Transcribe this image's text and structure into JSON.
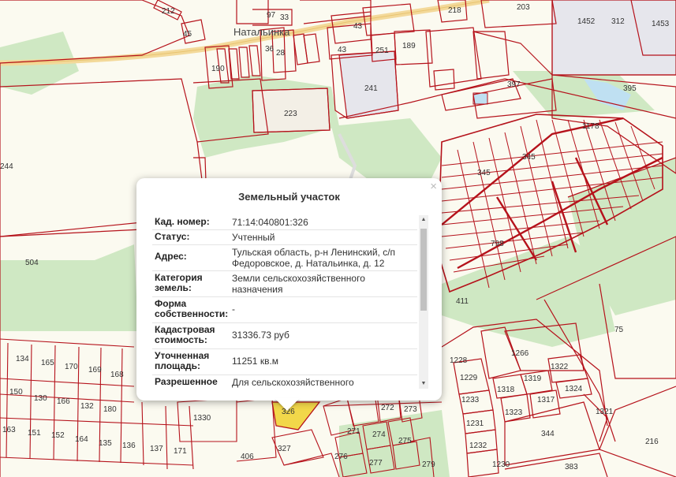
{
  "map": {
    "locality": "Натальинка",
    "labels": [
      "212",
      "45",
      "97",
      "33",
      "218",
      "203",
      "1452",
      "312",
      "1453",
      "43",
      "251",
      "189",
      "36",
      "28",
      "190",
      "43",
      "241",
      "397",
      "395",
      "223",
      "1178",
      "345",
      "345",
      "244",
      "504",
      "798",
      "411",
      "75",
      "1228",
      "1266",
      "1322",
      "1229",
      "1318",
      "1319",
      "1324",
      "1233",
      "1323",
      "1317",
      "1321",
      "1231",
      "344",
      "1232",
      "216",
      "1230",
      "383",
      "134",
      "165",
      "170",
      "169",
      "168",
      "150",
      "130",
      "166",
      "132",
      "180",
      "163",
      "151",
      "152",
      "164",
      "135",
      "136",
      "137",
      "171",
      "1330",
      "326",
      "272",
      "273",
      "271",
      "274",
      "275",
      "327",
      "276",
      "277",
      "279",
      "406"
    ]
  },
  "popup": {
    "title": "Земельный участок",
    "close_icon": "×",
    "rows": [
      {
        "key": "Кад. номер:",
        "value": "71:14:040801:326"
      },
      {
        "key": "Статус:",
        "value": "Учтенный"
      },
      {
        "key": "Адрес:",
        "value": "Тульская область, р-н Ленинский, с/п Федоровское, д. Натальинка, д. 12"
      },
      {
        "key": "Категория земель:",
        "value": "Земли сельскохозяйственного назначения"
      },
      {
        "key": "Форма собственности:",
        "value": "-"
      },
      {
        "key": "Кадастровая стоимость:",
        "value": "31336.73 руб"
      },
      {
        "key": "Уточненная площадь:",
        "value": "11251 кв.м"
      },
      {
        "key": "Разрешенное",
        "value": "Для сельскохозяйственного"
      }
    ],
    "scroll_up": "▲",
    "scroll_down": "▼"
  },
  "colors": {
    "boundary": "#b5121b",
    "green": "#cfe8c3",
    "industrial": "#e6e6ec",
    "road": "#f3d99a",
    "selected": "#f2d74a"
  }
}
